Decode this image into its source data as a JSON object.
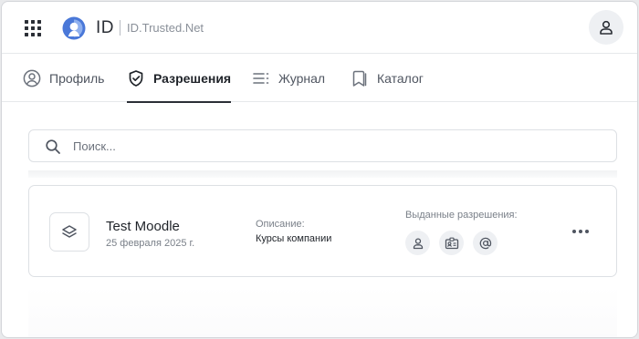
{
  "header": {
    "brand": "ID",
    "domain": "ID.Trusted.Net"
  },
  "icons": {
    "apps": "apps-grid-icon",
    "logo": "trusted-id-logo",
    "profile": "user-icon"
  },
  "tabs": [
    {
      "label": "Профиль",
      "icon": "user-circle-icon",
      "active": false
    },
    {
      "label": "Разрешения",
      "icon": "shield-check-icon",
      "active": true
    },
    {
      "label": "Журнал",
      "icon": "list-icon",
      "active": false
    },
    {
      "label": "Каталог",
      "icon": "bookmark-icon",
      "active": false
    }
  ],
  "search": {
    "placeholder": "Поиск...",
    "value": ""
  },
  "cards": [
    {
      "title": "Test Moodle",
      "date": "25 февраля 2025 г.",
      "description_label": "Описание:",
      "description": "Курсы компании",
      "permissions_label": "Выданные разрешения:",
      "permission_icons": [
        "user-icon",
        "id-card-icon",
        "at-sign-icon"
      ]
    }
  ],
  "colors": {
    "accent": "#2b2f36",
    "logo_blue": "#4a78d8",
    "muted": "#7a8089",
    "chip_bg": "#eef0f3"
  }
}
